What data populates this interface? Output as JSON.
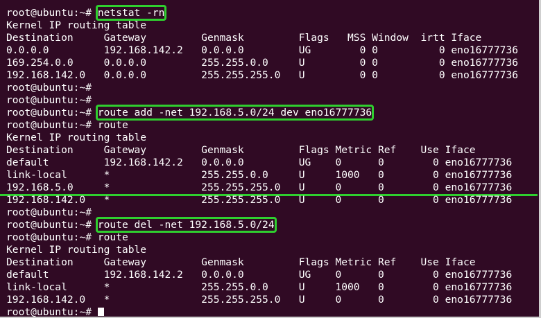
{
  "prompt": "root@ubuntu:~#",
  "commands": {
    "netstat": "netstat -rn",
    "route_add": "route add -net 192.168.5.0/24 dev eno16777736",
    "route1": "route",
    "route_del": "route del -net 192.168.5.0/24",
    "route2": "route"
  },
  "lines": {
    "l2": "Kernel IP routing table",
    "l3": "Destination     Gateway         Genmask         Flags   MSS Window  irtt Iface",
    "l4": "0.0.0.0         192.168.142.2   0.0.0.0         UG        0 0          0 eno16777736",
    "l5": "169.254.0.0     0.0.0.0         255.255.0.0     U         0 0          0 eno16777736",
    "l6": "192.168.142.0   0.0.0.0         255.255.255.0   U         0 0          0 eno16777736",
    "l11": "Kernel IP routing table",
    "l12": "Destination     Gateway         Genmask         Flags Metric Ref    Use Iface",
    "l13": "default         192.168.142.2   0.0.0.0         UG    0      0        0 eno16777736",
    "l14": "link-local      *               255.255.0.0     U     1000   0        0 eno16777736",
    "l15": "192.168.5.0     *               255.255.255.0   U     0      0        0 eno16777736",
    "l16": "192.168.142.0   *               255.255.255.0   U     0      0        0 eno16777736",
    "l20": "Kernel IP routing table",
    "l21": "Destination     Gateway         Genmask         Flags Metric Ref    Use Iface",
    "l22": "default         192.168.142.2   0.0.0.0         UG    0      0        0 eno16777736",
    "l23": "link-local      *               255.255.0.0     U     1000   0        0 eno16777736",
    "l24": "192.168.142.0   *               255.255.255.0   U     0      0        0 eno16777736"
  },
  "colors": {
    "background": "#300a24",
    "text": "#ffffff",
    "highlight": "#2fcf2f"
  }
}
